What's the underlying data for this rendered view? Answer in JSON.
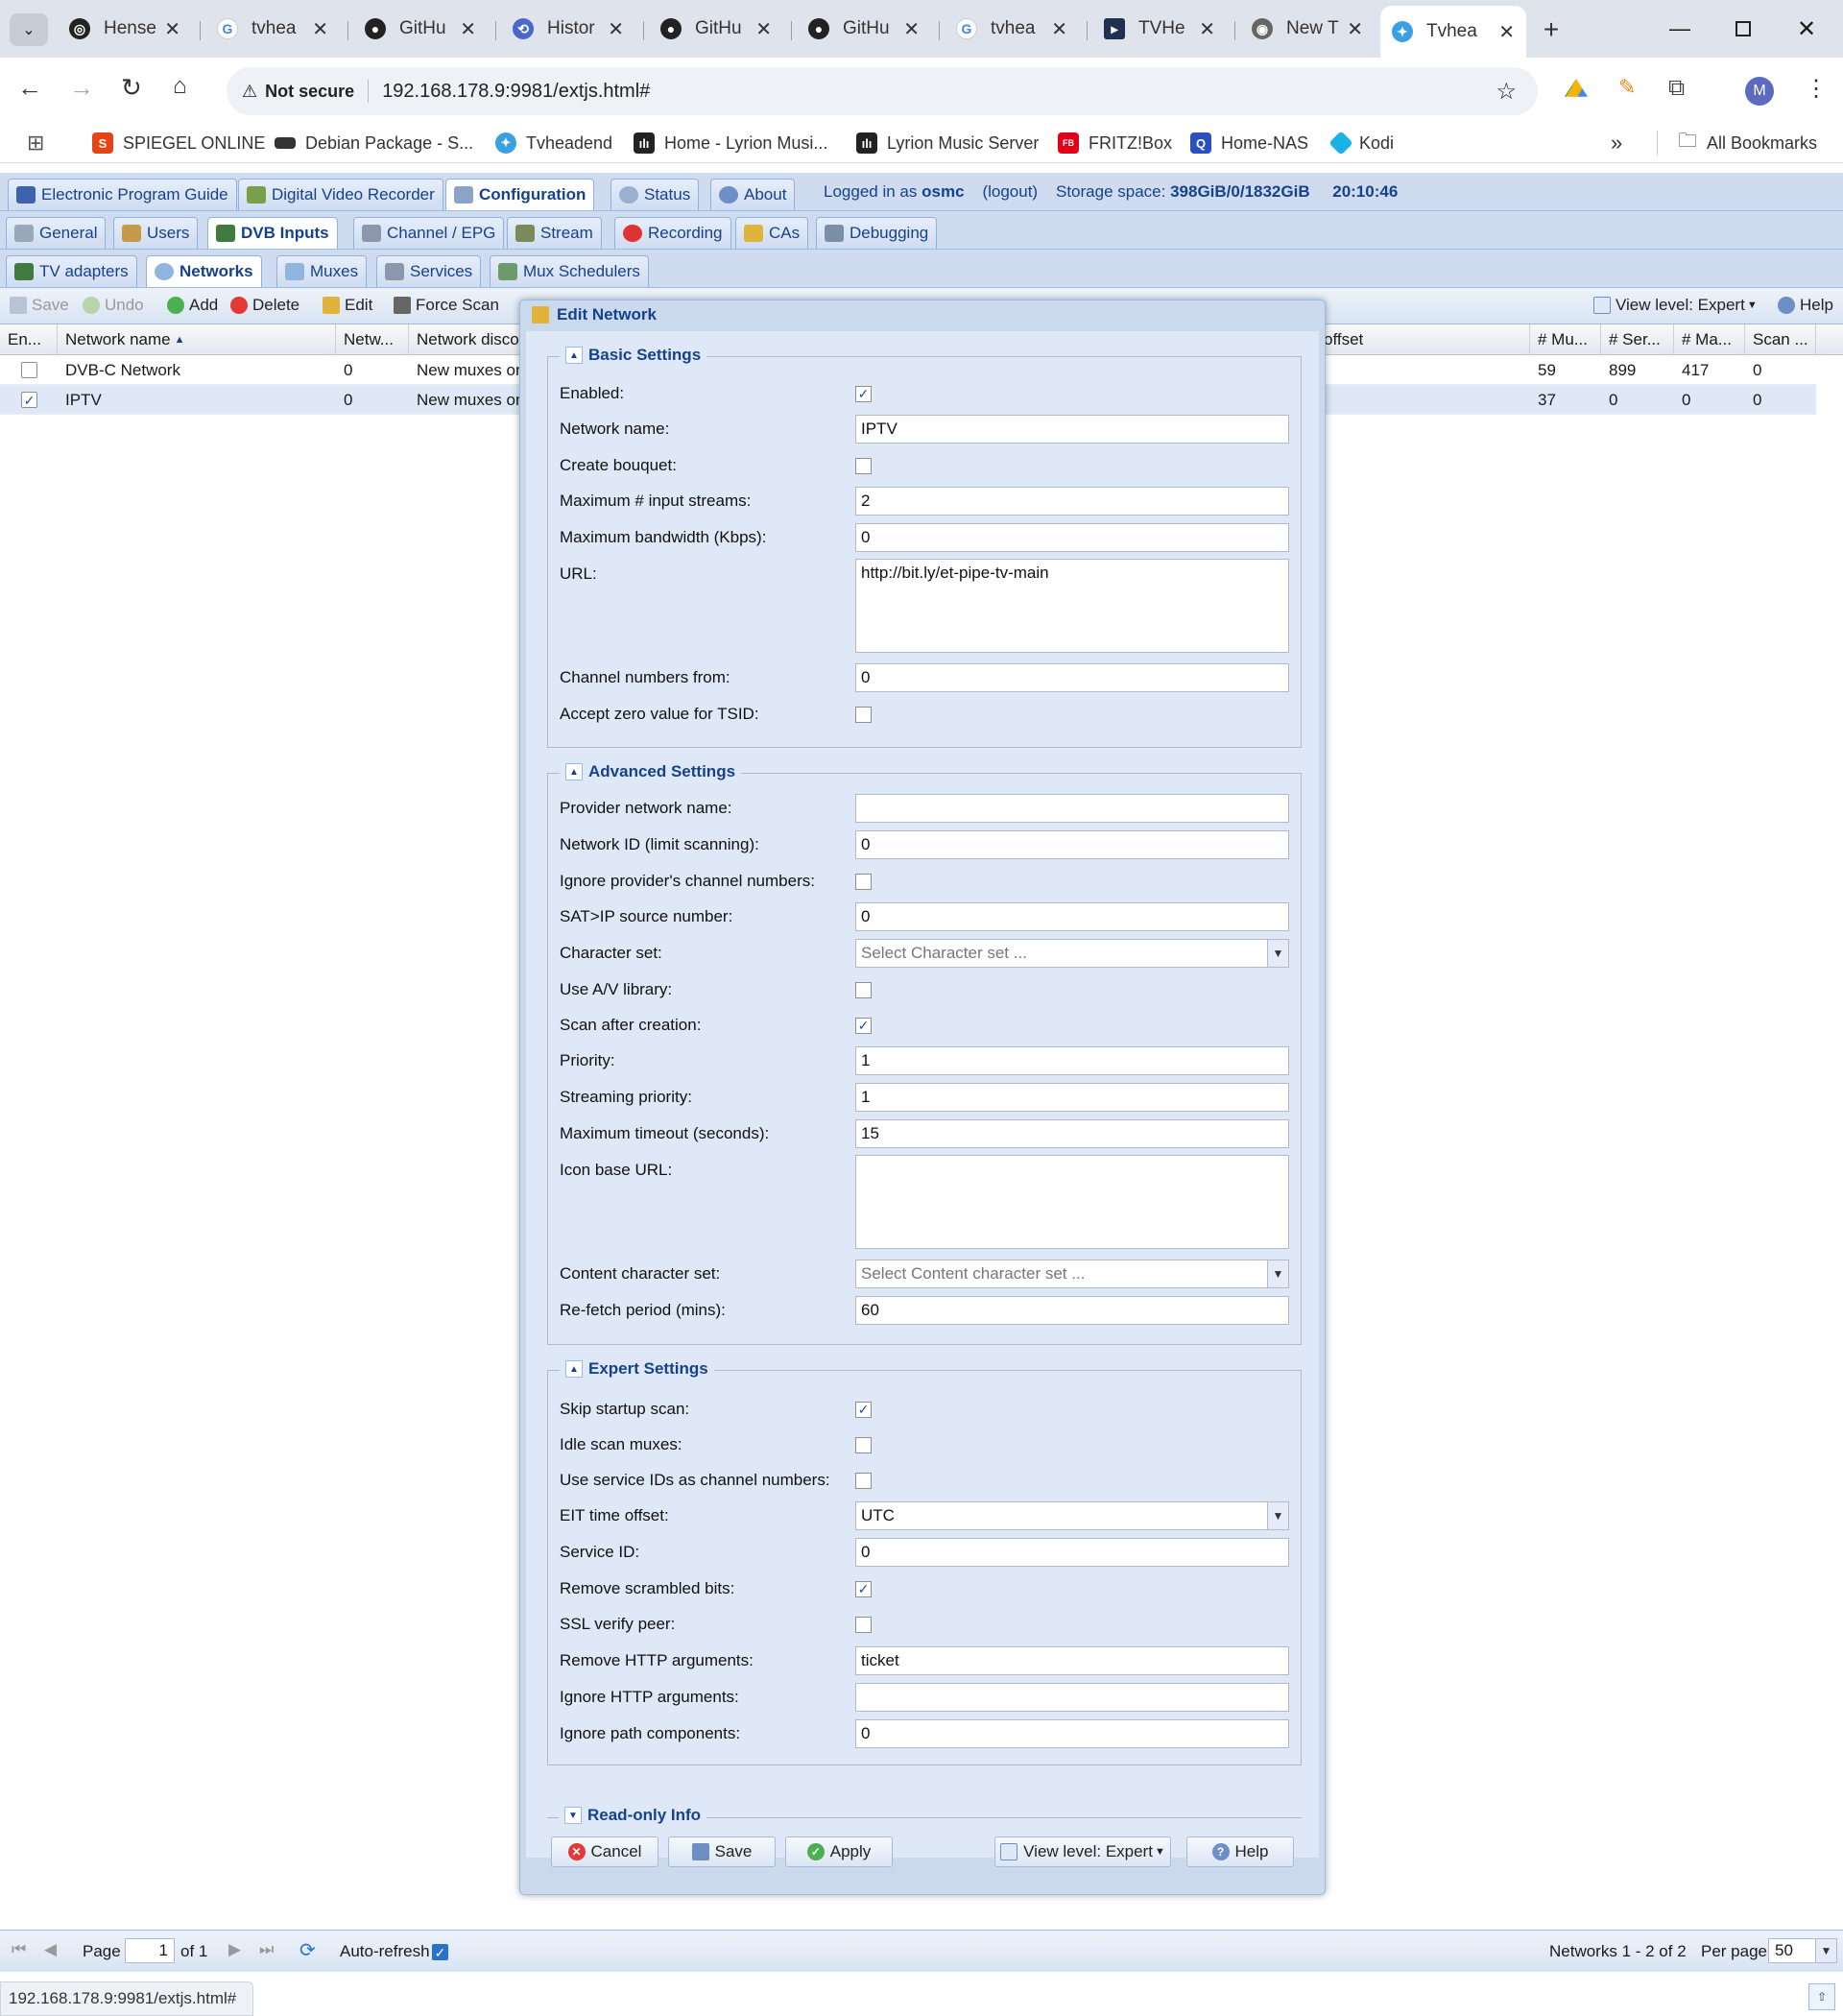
{
  "browser": {
    "tabs": [
      {
        "title": "Hense",
        "icon": "openai-icon"
      },
      {
        "title": "tvhea",
        "icon": "google-icon"
      },
      {
        "title": "GitHu",
        "icon": "github-icon"
      },
      {
        "title": "Histor",
        "icon": "history-icon"
      },
      {
        "title": "GitHu",
        "icon": "github-icon"
      },
      {
        "title": "GitHu",
        "icon": "github-icon"
      },
      {
        "title": "tvhea",
        "icon": "google-icon"
      },
      {
        "title": "TVHe",
        "icon": "tvheadend-icon"
      },
      {
        "title": "New T",
        "icon": "chrome-icon"
      },
      {
        "title": "Tvhea",
        "icon": "tvheadend-icon",
        "active": true
      }
    ],
    "security_label": "Not secure",
    "url": "192.168.178.9:9981/extjs.html#",
    "profile_initial": "M",
    "bookmarks": [
      "SPIEGEL ONLINE",
      "Debian Package - S...",
      "Tvheadend",
      "Home - Lyrion Musi...",
      "Lyrion Music Server",
      "FRITZ!Box",
      "Home-NAS",
      "Kodi"
    ],
    "more_bookmarks": "»",
    "all_bookmarks": "All Bookmarks",
    "status_url": "192.168.178.9:9981/extjs.html#"
  },
  "app": {
    "top_tabs": [
      "Electronic Program Guide",
      "Digital Video Recorder",
      "Configuration",
      "Status",
      "About"
    ],
    "logged_in_prefix": "Logged in as",
    "user": "osmc",
    "logout": "(logout)",
    "storage_label": "Storage space:",
    "storage_value": "398GiB/0/1832GiB",
    "time": "20:10:46",
    "config_tabs": [
      "General",
      "Users",
      "DVB Inputs",
      "Channel / EPG",
      "Stream",
      "Recording",
      "CAs",
      "Debugging"
    ],
    "dvb_tabs": [
      "TV adapters",
      "Networks",
      "Muxes",
      "Services",
      "Mux Schedulers"
    ],
    "toolbar": {
      "save": "Save",
      "undo": "Undo",
      "add": "Add",
      "delete": "Delete",
      "edit": "Edit",
      "force_scan": "Force Scan",
      "view_level": "View level: Expert",
      "help": "Help"
    },
    "grid": {
      "headers": [
        "En...",
        "Network name",
        "Netw...",
        "Network disco",
        "offset",
        "# Mu...",
        "# Ser...",
        "# Ma...",
        "Scan ..."
      ],
      "rows": [
        {
          "enabled": false,
          "name": "DVB-C Network",
          "netw": "0",
          "disco": "New muxes on",
          "muxes": "59",
          "services": "899",
          "mapped": "417",
          "scan": "0"
        },
        {
          "enabled": true,
          "name": "IPTV",
          "netw": "0",
          "disco": "New muxes on",
          "muxes": "37",
          "services": "0",
          "mapped": "0",
          "scan": "0"
        }
      ]
    },
    "paging": {
      "page_label": "Page",
      "page": "1",
      "of": "of 1",
      "auto_refresh": "Auto-refresh",
      "summary": "Networks 1 - 2 of 2",
      "per_page_label": "Per page",
      "per_page": "50"
    }
  },
  "dialog": {
    "title": "Edit Network",
    "basic": {
      "legend": "Basic Settings",
      "enabled": {
        "label": "Enabled:",
        "checked": true
      },
      "network_name": {
        "label": "Network name:",
        "value": "IPTV"
      },
      "create_bouquet": {
        "label": "Create bouquet:",
        "checked": false
      },
      "max_streams": {
        "label": "Maximum # input streams:",
        "value": "2"
      },
      "max_bandwidth": {
        "label": "Maximum bandwidth (Kbps):",
        "value": "0"
      },
      "url": {
        "label": "URL:",
        "value": "http://bit.ly/et-pipe-tv-main"
      },
      "channel_numbers_from": {
        "label": "Channel numbers from:",
        "value": "0"
      },
      "accept_zero_tsid": {
        "label": "Accept zero value for TSID:",
        "checked": false
      }
    },
    "advanced": {
      "legend": "Advanced Settings",
      "provider_network_name": {
        "label": "Provider network name:",
        "value": ""
      },
      "network_id": {
        "label": "Network ID (limit scanning):",
        "value": "0"
      },
      "ignore_provider_numbers": {
        "label": "Ignore provider's channel numbers:",
        "checked": false
      },
      "satip_source": {
        "label": "SAT>IP source number:",
        "value": "0"
      },
      "charset": {
        "label": "Character set:",
        "placeholder": "Select Character set ..."
      },
      "use_av_library": {
        "label": "Use A/V library:",
        "checked": false
      },
      "scan_after_creation": {
        "label": "Scan after creation:",
        "checked": true
      },
      "priority": {
        "label": "Priority:",
        "value": "1"
      },
      "streaming_priority": {
        "label": "Streaming priority:",
        "value": "1"
      },
      "max_timeout": {
        "label": "Maximum timeout (seconds):",
        "value": "15"
      },
      "icon_base_url": {
        "label": "Icon base URL:",
        "value": ""
      },
      "content_charset": {
        "label": "Content character set:",
        "placeholder": "Select Content character set ..."
      },
      "refetch_period": {
        "label": "Re-fetch period (mins):",
        "value": "60"
      }
    },
    "expert": {
      "legend": "Expert Settings",
      "skip_startup_scan": {
        "label": "Skip startup scan:",
        "checked": true
      },
      "idle_scan_muxes": {
        "label": "Idle scan muxes:",
        "checked": false
      },
      "use_service_ids": {
        "label": "Use service IDs as channel numbers:",
        "checked": false
      },
      "eit_offset": {
        "label": "EIT time offset:",
        "value": "UTC"
      },
      "service_id": {
        "label": "Service ID:",
        "value": "0"
      },
      "remove_scrambled": {
        "label": "Remove scrambled bits:",
        "checked": true
      },
      "ssl_verify": {
        "label": "SSL verify peer:",
        "checked": false
      },
      "remove_http_args": {
        "label": "Remove HTTP arguments:",
        "value": "ticket"
      },
      "ignore_http_args": {
        "label": "Ignore HTTP arguments:",
        "value": ""
      },
      "ignore_path_components": {
        "label": "Ignore path components:",
        "value": "0"
      }
    },
    "readonly_legend": "Read-only Info",
    "buttons": {
      "cancel": "Cancel",
      "save": "Save",
      "apply": "Apply",
      "view_level": "View level: Expert",
      "help": "Help"
    }
  },
  "colors": {
    "accent": "#15428b",
    "panel": "#dfe8f6",
    "tabbar": "#cfdcf0",
    "chrome": "#dfe3eb"
  }
}
